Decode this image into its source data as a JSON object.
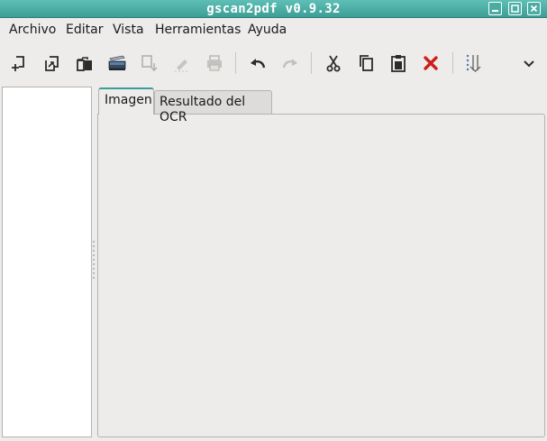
{
  "window": {
    "title": "gscan2pdf v0.9.32",
    "title_color": "#ffffff",
    "titlebar_color": "#4aada4",
    "controls": [
      "minimize-icon",
      "maximize-icon",
      "close-icon"
    ]
  },
  "menubar": {
    "items": [
      {
        "label": "Archivo"
      },
      {
        "label": "Editar"
      },
      {
        "label": "Vista"
      },
      {
        "label": "Herramientas"
      },
      {
        "label": "Ayuda"
      }
    ]
  },
  "toolbar": {
    "buttons": [
      {
        "icon": "new-page-icon",
        "enabled": true
      },
      {
        "icon": "import-icon",
        "enabled": true
      },
      {
        "icon": "open-folder-icon",
        "enabled": true
      },
      {
        "icon": "scanner-icon",
        "enabled": true
      },
      {
        "icon": "save-icon",
        "enabled": false
      },
      {
        "icon": "edit-pencil-icon",
        "enabled": false
      },
      {
        "icon": "print-icon",
        "enabled": false
      },
      {
        "icon": "undo-icon",
        "enabled": true
      },
      {
        "icon": "redo-icon",
        "enabled": false
      },
      {
        "icon": "cut-icon",
        "enabled": true
      },
      {
        "icon": "copy-icon",
        "enabled": true
      },
      {
        "icon": "paste-icon",
        "enabled": true
      },
      {
        "icon": "delete-icon",
        "enabled": true,
        "color": "#cc1f1a"
      },
      {
        "icon": "renumber-icon",
        "enabled": true
      },
      {
        "icon": "overflow-chevron-icon",
        "enabled": true
      }
    ]
  },
  "tabs": [
    {
      "label": "Imagen",
      "active": true
    },
    {
      "label": "Resultado del OCR",
      "active": false
    }
  ],
  "colors": {
    "window_bg": "#edeceb",
    "accent": "#3d9e96",
    "border": "#b5b3b0"
  }
}
